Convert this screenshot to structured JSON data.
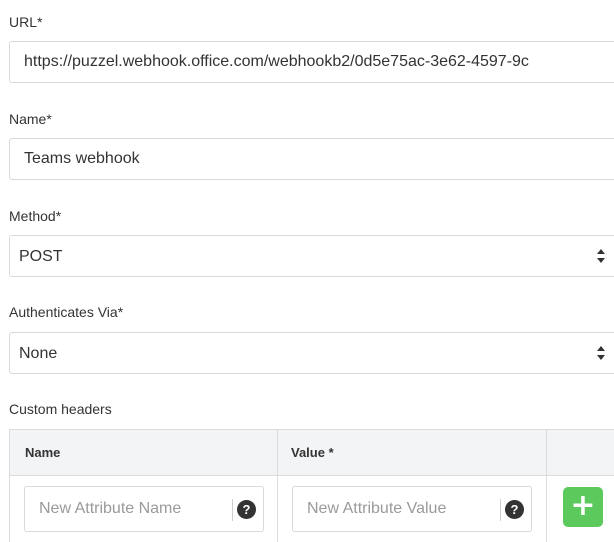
{
  "url_field": {
    "label": "URL*",
    "value": "https://puzzel.webhook.office.com/webhookb2/0d5e75ac-3e62-4597-9c"
  },
  "name_field": {
    "label": "Name*",
    "value": "Teams webhook"
  },
  "method_field": {
    "label": "Method*",
    "value": "POST",
    "icon": "sort-arrows-icon"
  },
  "auth_field": {
    "label": "Authenticates Via*",
    "value": "None",
    "icon": "sort-arrows-icon"
  },
  "custom_headers": {
    "label": "Custom headers",
    "columns": [
      "Name",
      "Value *",
      ""
    ],
    "new_row": {
      "name_placeholder": "New Attribute Name",
      "value_placeholder": "New Attribute Value",
      "help_icon": "question-circle-icon",
      "help_glyph": "?",
      "add_icon": "plus-icon",
      "add_glyph": "+"
    }
  },
  "colors": {
    "add_button": "#5bc95b",
    "header_bg": "#f3f4f6",
    "border": "#d9d9d9",
    "text": "#333333",
    "placeholder": "#9a9a9a"
  }
}
